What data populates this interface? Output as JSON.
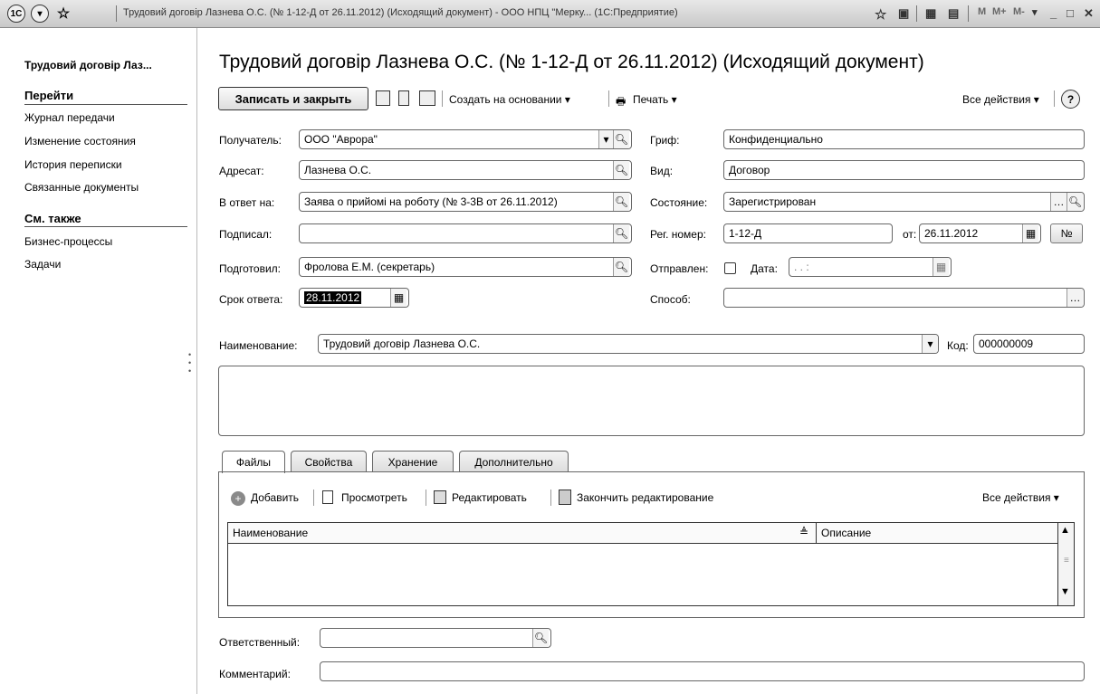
{
  "window": {
    "title": "Трудовий договір Лазнева О.С. (№ 1-12-Д от 26.11.2012) (Исходящий документ) - ООО НПЦ \"Мерку... (1С:Предприятие)",
    "logo_text": "1C",
    "m_labels": [
      "M",
      "M+",
      "M-"
    ]
  },
  "nav": {
    "title": "Трудовий договір Лаз...",
    "goto_header": "Перейти",
    "goto_items": [
      "Журнал передачи",
      "Изменение состояния",
      "История переписки",
      "Связанные документы"
    ],
    "see_also_header": "См. также",
    "see_also_items": [
      "Бизнес-процессы",
      "Задачи"
    ]
  },
  "doc": {
    "title": "Трудовий договір Лазнева О.С. (№ 1-12-Д от 26.11.2012) (Исходящий документ)"
  },
  "toolbar": {
    "save_close": "Записать и закрыть",
    "create_based": "Создать на основании ▾",
    "print": "Печать ▾",
    "all_actions": "Все действия ▾",
    "help": "?"
  },
  "form": {
    "recipient_label": "Получатель:",
    "recipient_value": "ООО \"Аврора\"",
    "addressee_label": "Адресат:",
    "addressee_value": "Лазнева О.С.",
    "reply_label": "В ответ на:",
    "reply_value": "Заява о прийомі на роботу (№ 3-3В от 26.11.2012)",
    "signed_label": "Подписал:",
    "signed_value": "",
    "prepared_label": "Подготовил:",
    "prepared_value": "Фролова Е.М. (секретарь)",
    "deadline_label": "Срок ответа:",
    "deadline_value": "28.11.2012",
    "grif_label": "Гриф:",
    "grif_value": "Конфиденциально",
    "kind_label": "Вид:",
    "kind_value": "Договор",
    "state_label": "Состояние:",
    "state_value": "Зарегистрирован",
    "regnum_label": "Рег. номер:",
    "regnum_value": "1-12-Д",
    "from_label": "от:",
    "from_value": "26.11.2012",
    "num_btn": "№",
    "sent_label": "Отправлен:",
    "date_label": "Дата:",
    "date_value": ". .   :",
    "method_label": "Способ:",
    "method_value": "",
    "name_label": "Наименование:",
    "name_value": "Трудовий договір Лазнева О.С.",
    "code_label": "Код:",
    "code_value": "000000009",
    "description": ""
  },
  "tabs": [
    "Файлы",
    "Свойства",
    "Хранение",
    "Дополнительно"
  ],
  "files": {
    "add": "Добавить",
    "view": "Просмотреть",
    "edit": "Редактировать",
    "finish_edit": "Закончить редактирование",
    "all_actions": "Все действия ▾",
    "col_name": "Наименование",
    "col_desc": "Описание"
  },
  "footer": {
    "responsible_label": "Ответственный:",
    "responsible_value": "",
    "comment_label": "Комментарий:",
    "comment_value": ""
  }
}
